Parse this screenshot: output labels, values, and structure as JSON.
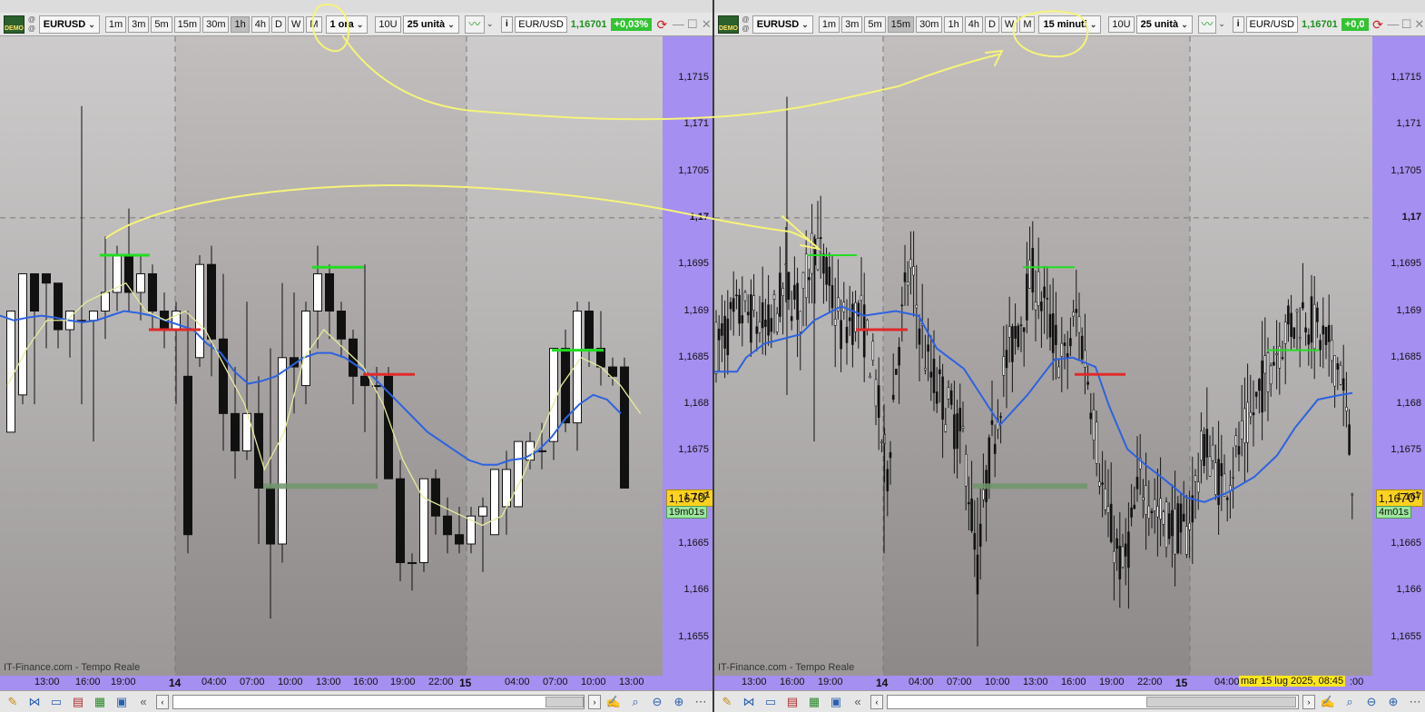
{
  "left": {
    "logo_text": "DEMO",
    "symbol": "EURUSD",
    "timeframes": [
      "1m",
      "3m",
      "5m",
      "15m",
      "30m",
      "1h",
      "4h",
      "D",
      "W",
      "M"
    ],
    "active_timeframe": "1h",
    "interval_select": "1 ora",
    "units_button": "10U",
    "units_select": "25 unità",
    "quote_symbol": "EUR/USD",
    "quote_price": "1,16701",
    "quote_change": "+0,03%",
    "price_labels": [
      "1,1715",
      "1,171",
      "1,1705",
      "1,17",
      "1,1695",
      "1,169",
      "1,1685",
      "1,168",
      "1,1675",
      "1,167",
      "1,1665",
      "1,166",
      "1,1655"
    ],
    "current_price_prefix": "1,16",
    "current_price_big": "70",
    "current_price_suffix": "1",
    "countdown": "19m01s",
    "watermark": "IT-Finance.com - Tempo Reale",
    "time_labels": [
      "13:00",
      "16:00",
      "19:00",
      "14",
      "04:00",
      "07:00",
      "10:00",
      "13:00",
      "16:00",
      "19:00",
      "22:00",
      "15",
      "04:00",
      "07:00",
      "10:00",
      "13:00"
    ]
  },
  "right": {
    "logo_text": "DEMO",
    "symbol": "EURUSD",
    "timeframes": [
      "1m",
      "3m",
      "5m",
      "15m",
      "30m",
      "1h",
      "4h",
      "D",
      "W",
      "M"
    ],
    "active_timeframe": "15m",
    "interval_select": "15 minuti",
    "units_button": "10U",
    "units_select": "25 unità",
    "quote_symbol": "EUR/USD",
    "quote_price": "1,16701",
    "quote_change": "+0,0",
    "price_labels": [
      "1,1715",
      "1,171",
      "1,1705",
      "1,17",
      "1,1695",
      "1,169",
      "1,1685",
      "1,168",
      "1,1675",
      "1,167",
      "1,1665",
      "1,166",
      "1,1655"
    ],
    "current_price_prefix": "1,16",
    "current_price_big": "70",
    "current_price_suffix": "1",
    "countdown": "4m01s",
    "watermark": "IT-Finance.com - Tempo Reale",
    "time_labels": [
      "13:00",
      "16:00",
      "19:00",
      "14",
      "04:00",
      "07:00",
      "10:00",
      "13:00",
      "16:00",
      "19:00",
      "22:00",
      "15",
      "04:00",
      ":00"
    ],
    "cursor_tooltip": "mar 15 lug 2025, 08:45"
  },
  "colors": {
    "price_axis": "#a58ff0",
    "ma_blue": "#2d62e0",
    "ma_yellow": "#e6eb9a",
    "level_green": "#22dd22",
    "level_red": "#e02a2a",
    "annotation": "#f6f37a",
    "current_price_bg": "#ffd21f"
  },
  "icons": [
    "demo-logo-icon",
    "indicator-icon",
    "info-icon",
    "link-icon",
    "minimize-icon",
    "maximize-icon",
    "close-icon",
    "pencil-icon",
    "share-icon",
    "chat-icon",
    "list-icon",
    "strategy-icon",
    "screener-icon",
    "zoom-fit-icon",
    "zoom-out-icon",
    "zoom-in-icon",
    "chevron-left-icon",
    "chevron-right-icon"
  ]
}
